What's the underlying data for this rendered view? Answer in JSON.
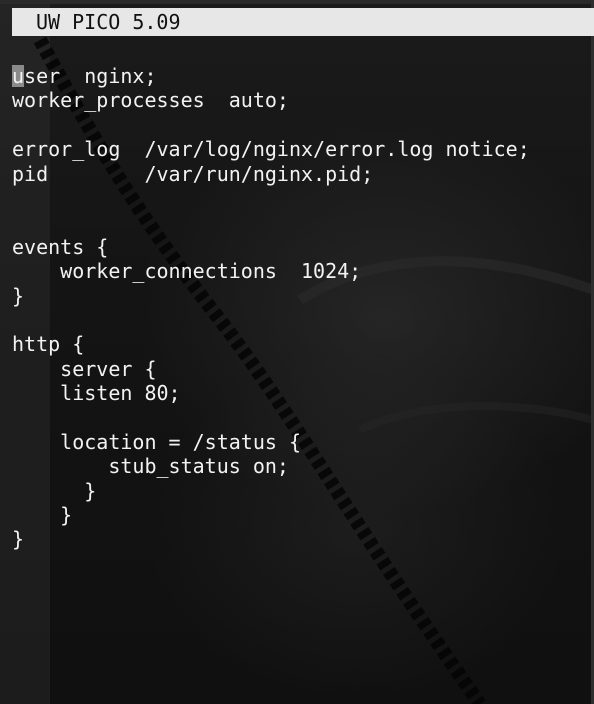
{
  "title_bar": {
    "title": "UW PICO 5.09"
  },
  "editor": {
    "lines": [
      "user  nginx;",
      "worker_processes  auto;",
      "",
      "error_log  /var/log/nginx/error.log notice;",
      "pid        /var/run/nginx.pid;",
      "",
      "",
      "events {",
      "    worker_connections  1024;",
      "}",
      "",
      "http {",
      "    server {",
      "    listen 80;",
      "",
      "    location = /status {",
      "        stub_status on;",
      "      }",
      "    }",
      "}"
    ]
  },
  "colors": {
    "title_bar_background": "#e7e7e7",
    "title_bar_text": "#111111",
    "editor_text": "#f2f2f2",
    "cursor": "#8a8a8a"
  }
}
